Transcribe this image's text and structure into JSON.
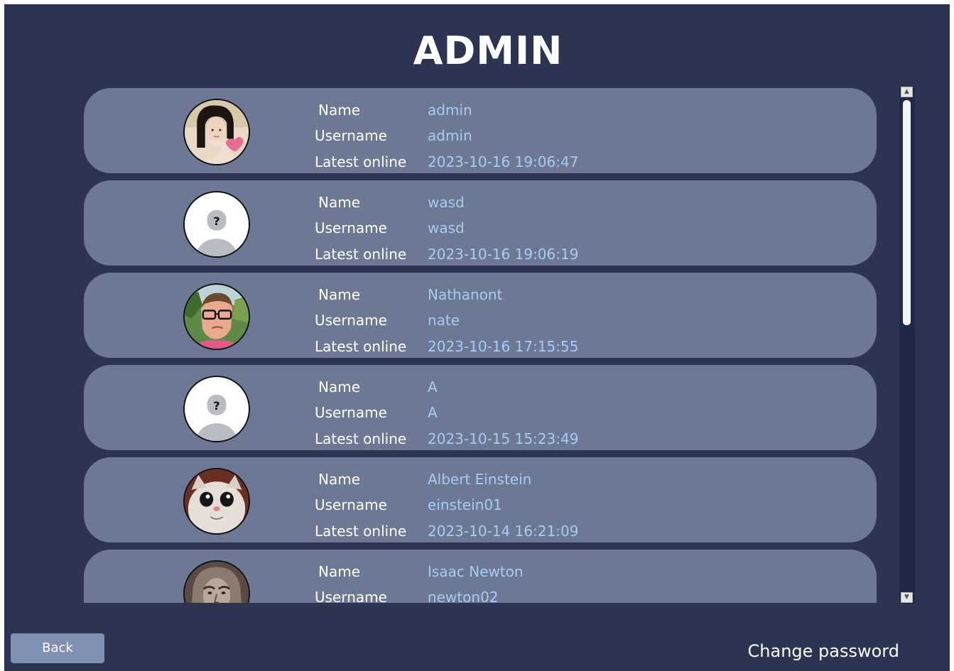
{
  "page_title": "ADMIN",
  "labels": {
    "name": "Name",
    "username": "Username",
    "latest_online": "Latest online"
  },
  "users": [
    {
      "name": "admin",
      "username": "admin",
      "latest_online": "2023-10-16 19:06:47",
      "avatar": "photo-girl-avatar"
    },
    {
      "name": "wasd",
      "username": "wasd",
      "latest_online": "2023-10-16 19:06:19",
      "avatar": "default-avatar-icon"
    },
    {
      "name": "Nathanont",
      "username": "nate",
      "latest_online": "2023-10-16 17:15:55",
      "avatar": "photo-man-glasses-avatar"
    },
    {
      "name": "A",
      "username": "A",
      "latest_online": "2023-10-15 15:23:49",
      "avatar": "default-avatar-icon"
    },
    {
      "name": "Albert Einstein",
      "username": "einstein01",
      "latest_online": "2023-10-14 16:21:09",
      "avatar": "photo-cat-avatar"
    },
    {
      "name": "Isaac Newton",
      "username": "newton02",
      "latest_online": "",
      "avatar": "photo-portrait-avatar"
    }
  ],
  "footer": {
    "back_label": "Back",
    "change_password_label": "Change password"
  },
  "colors": {
    "background": "#2d3452",
    "card": "#6d7894",
    "value_text": "#a6ccf3",
    "scroll_track": "#1f2848",
    "back_button": "#8190b2"
  }
}
